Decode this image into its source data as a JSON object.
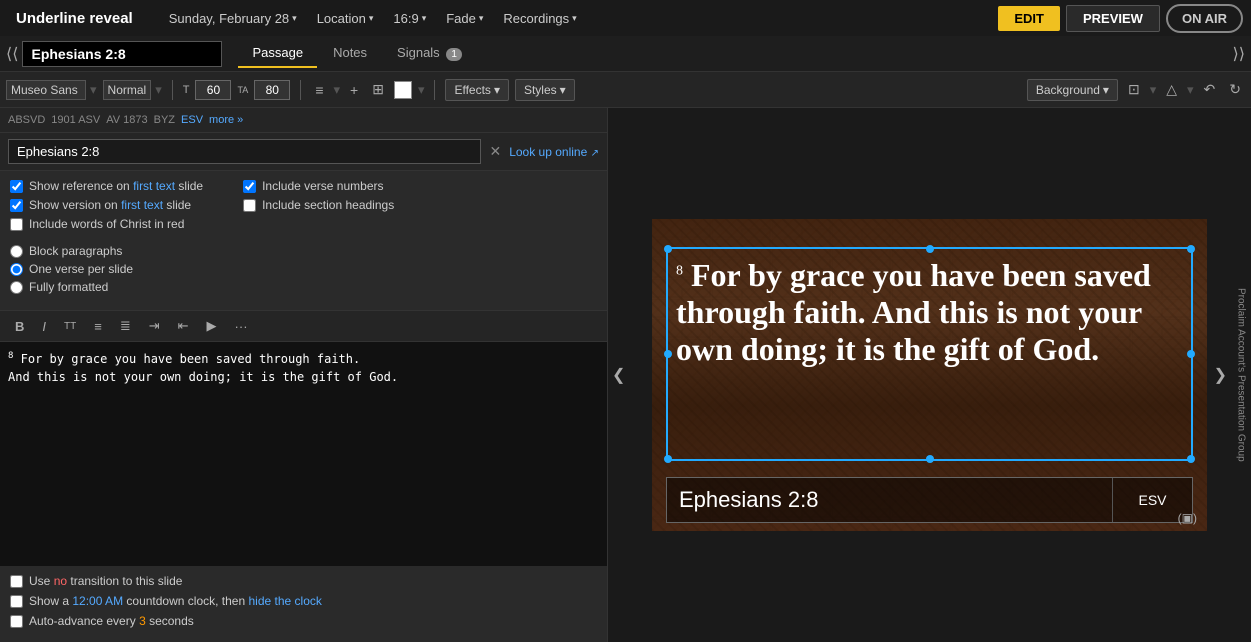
{
  "app": {
    "title": "Underline reveal"
  },
  "topbar": {
    "date": "Sunday, February 28",
    "location": "Location",
    "aspect": "16:9",
    "transition": "Fade",
    "recordings": "Recordings",
    "edit_label": "EDIT",
    "preview_label": "PREVIEW",
    "onair_label": "ON AIR"
  },
  "secondbar": {
    "slide_title": "Ephesians 2:8",
    "tabs": [
      {
        "label": "Passage",
        "active": true
      },
      {
        "label": "Notes",
        "active": false
      },
      {
        "label": "Signals",
        "active": false,
        "badge": "1"
      }
    ]
  },
  "toolbar": {
    "font_family": "Museo Sans",
    "font_style": "Normal",
    "font_size_t": "60",
    "font_size_a": "80",
    "effects": "Effects",
    "styles": "Styles",
    "background": "Background"
  },
  "version_bar": {
    "versions": [
      "ABSVD",
      "1901 ASV",
      "AV 1873",
      "BYZ",
      "ESV",
      "more »"
    ]
  },
  "search": {
    "value": "Ephesians 2:8",
    "lookup_label": "Look up online"
  },
  "options": {
    "show_reference": "Show reference on",
    "reference_link": "first text",
    "reference_suffix": "slide",
    "show_version": "Show version on",
    "version_link": "first text",
    "version_suffix": "slide",
    "words_of_christ": "Include words of Christ in red",
    "include_verse_numbers": "Include verse numbers",
    "include_section_headings": "Include section headings",
    "block_paragraphs": "Block paragraphs",
    "one_verse": "One verse per slide",
    "fully_formatted": "Fully formatted"
  },
  "editor": {
    "text": "⁸ For by grace you have been saved through faith. And this is not your own doing; it is the gift of God.",
    "line1": "⁸ For by grace you have been saved through faith.",
    "line2": "And this is not your own doing; it is the gift of God."
  },
  "bottom_options": {
    "no_transition": "Use",
    "no_highlight": "no",
    "no_transition_suffix": "transition to this slide",
    "countdown": "Show a",
    "countdown_time": "12:00 AM",
    "countdown_mid": "countdown clock, then",
    "hide_clock": "hide the clock",
    "auto_advance": "Auto-advance every",
    "auto_num": "3",
    "auto_suffix": "seconds"
  },
  "slide": {
    "verse_num": "8",
    "verse_text": "For by grace you have been saved through faith. And this is not your own doing; it is the gift of God.",
    "reference": "Ephesians 2:8",
    "version": "ESV"
  },
  "sidebar_right_label": "Proclaim Account's Presentation Group"
}
